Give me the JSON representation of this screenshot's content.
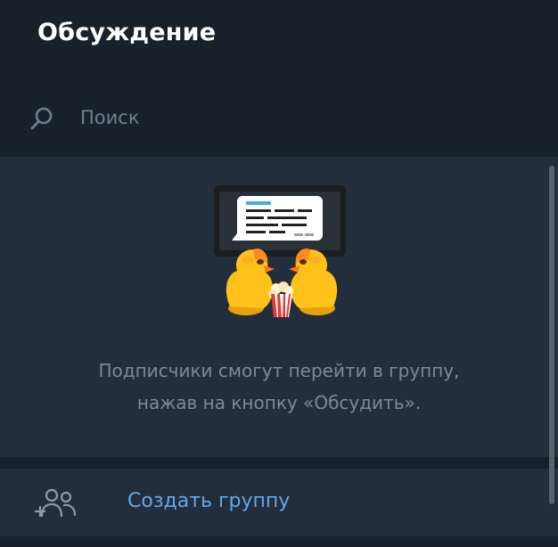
{
  "header": {
    "title": "Обсуждение"
  },
  "search": {
    "placeholder": "Поиск",
    "value": "",
    "icon": "search-icon"
  },
  "empty_state": {
    "illustration": "popcorn-ducks-illustration",
    "hint_lines": [
      "Подписчики смогут перейти в группу,",
      "нажав на кнопку «Обсудить»."
    ]
  },
  "action": {
    "label": "Создать группу",
    "icon": "add-group-icon"
  },
  "colors": {
    "background": "#17212b",
    "panel": "#232e3c",
    "accent": "#61a8e6",
    "muted_text": "#7a8a9a",
    "placeholder": "#6d7f8f"
  }
}
